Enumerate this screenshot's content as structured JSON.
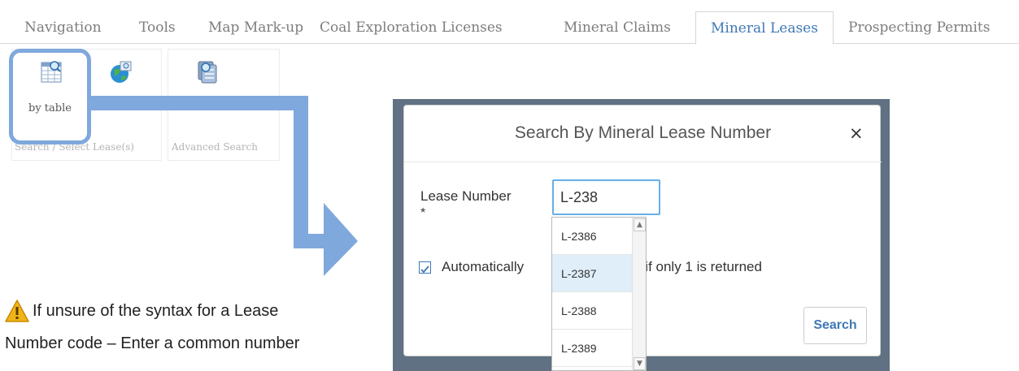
{
  "tabs": [
    {
      "label": "Navigation",
      "active": false
    },
    {
      "label": "Tools",
      "active": false
    },
    {
      "label": "Map Mark-up",
      "active": false
    },
    {
      "label": "Coal Exploration Licenses",
      "active": false
    },
    {
      "label": "Mineral Claims",
      "active": false
    },
    {
      "label": "Mineral Leases",
      "active": true
    },
    {
      "label": "Prospecting Permits",
      "active": false
    }
  ],
  "ribbon": {
    "search_group": {
      "label": "Search / Select Lease(s)",
      "tools": [
        {
          "name": "by table",
          "icon": "table-search-icon"
        },
        {
          "name": "",
          "icon": "globe-search-icon"
        }
      ]
    },
    "advanced_group": {
      "label": "Advanced Search",
      "tools": [
        {
          "name": "",
          "icon": "stack-search-icon"
        }
      ]
    }
  },
  "dialog": {
    "title": "Search By Mineral Lease Number",
    "close": "×",
    "field_label": "Lease Number",
    "required_marker": "*",
    "input_value": "L-238",
    "checkbox_checked": true,
    "checkbox_text_prefix": "Automatically",
    "checkbox_text_suffix": "e result, if only 1 is returned",
    "search_button": "Search"
  },
  "dropdown": {
    "options": [
      "L-2386",
      "L-2387",
      "L-2388",
      "L-2389"
    ],
    "highlighted": "L-2387"
  },
  "note": {
    "line1": "If unsure of the syntax for a Lease",
    "line2": "Number code –  Enter a common number"
  },
  "colors": {
    "accent": "#3f78b5",
    "highlight_outline": "#7fa8dc",
    "warning": "#f0b419"
  }
}
